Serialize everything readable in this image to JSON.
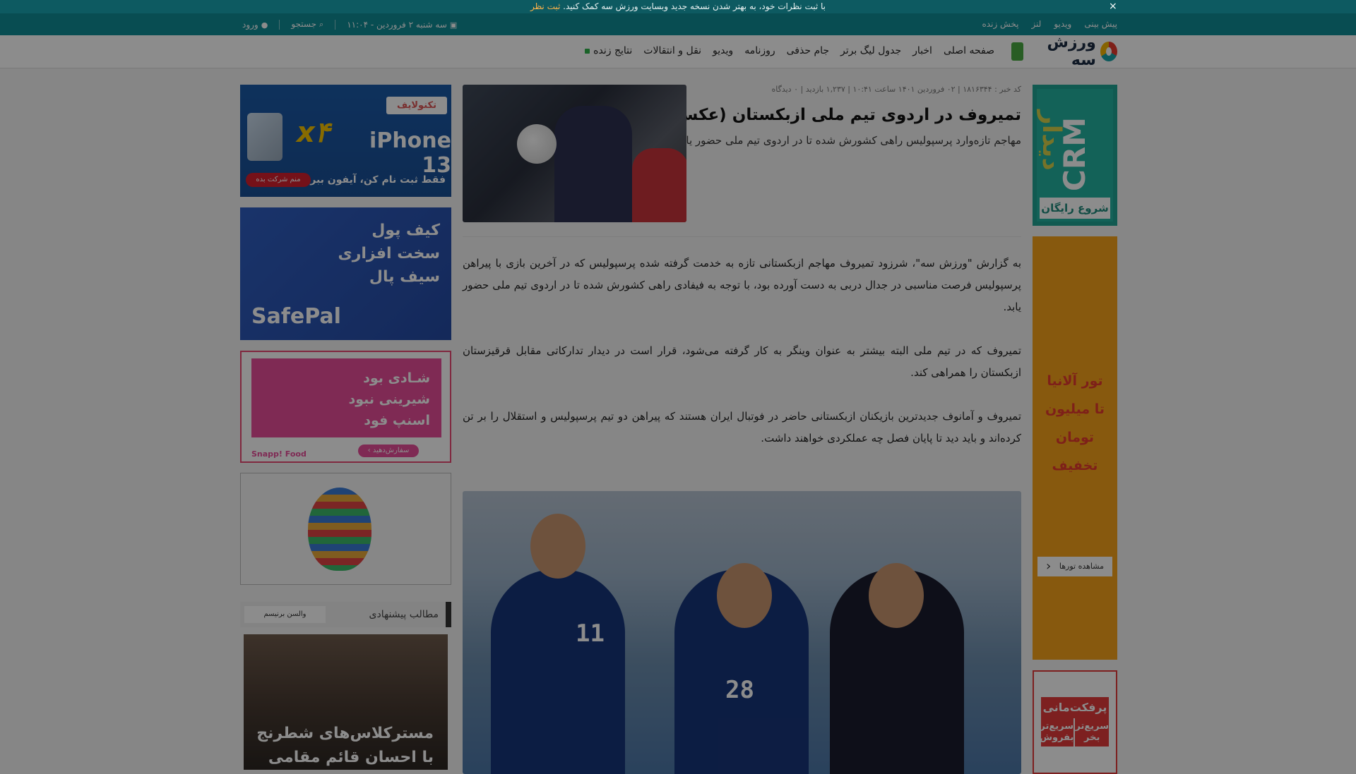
{
  "banner": {
    "text": "با ثبت نظرات خود، به بهتر شدن نسخه جدید وبسایت ورزش سه کمک کنید.",
    "link": "ثبت نظر",
    "close": "×"
  },
  "topbar": {
    "links": [
      "پیش بینی",
      "ویدیو",
      "لنز",
      "پخش زنده"
    ],
    "date": "سه شنبه ۲ فروردین - ۱۱:۰۴",
    "search": "جستجو",
    "login": "ورود"
  },
  "logo": {
    "text": "ورزش سه"
  },
  "nav": {
    "items": [
      "صفحه اصلی",
      "اخبار",
      "جدول لیگ برتر",
      "جام حذفی",
      "روزنامه",
      "ویدیو",
      "نقل و انتقالات"
    ],
    "live": "نتایج زنده"
  },
  "article": {
    "meta": "کد خبر : ۱۸۱۶۳۴۴ | ۰۲ فروردین ۱۴۰۱ ساعت ۱۰:۴۱ | ۱,۲۳۷ بازدید | ۰ دیدگاه",
    "title": "تمیروف در اردوی تیم ملی ازبکستان (عکس)",
    "lead": "مهاجم تازه‌وارد پرسپولیس راهی کشورش شده تا در اردوی تیم ملی حضور یابد.",
    "paragraphs": [
      "به گزارش \"ورزش سه\"، شرزود تمیروف مهاجم ازبکستانی تازه به خدمت گرفته شده پرسپولیس که در آخرین بازی با پیراهن پرسپولیس فرصت مناسبی در جدال دربی به دست آورده بود، با توجه به فیفادی راهی کشورش شده تا در اردوی تیم ملی حضور یابد.",
      "تمیروف که در تیم ملی البته بیشتر به عنوان وینگر به کار گرفته می‌شود، قرار است در دیدار تدارکاتی مقابل قرقیزستان ازبکستان را همراهی کند.",
      "تمیروف و آمانوف جدیدترین بازیکنان ازبکستانی حاضر در فوتبال ایران هستند که پیراهن دو تیم پرسپولیس و استقلال را بر تن کرده‌اند و باید دید تا پایان فصل چه عملکردی خواهند داشت."
    ],
    "photo_numbers": [
      "11",
      "28"
    ]
  },
  "ads": {
    "crm": {
      "title": "CRM",
      "brand": "دیدار",
      "button": "شروع رایگان"
    },
    "tour": {
      "lines": [
        "تور آلانیا",
        "تا میلیون تومان",
        "تخفیف"
      ],
      "button": "مشاهده تورها"
    },
    "perfect": {
      "title": "پرفکت‌مانی",
      "left": "سریع‌تر بفروش",
      "right": "سریع‌تر بخر"
    },
    "iphone": {
      "brand": "تکنولایف",
      "model": "iPhone 13",
      "multiplier": "x۴",
      "cta": "فقط ثبت نام کن، آیفون ببر!",
      "button": "منم شرکت بده"
    },
    "safepal": {
      "lines": [
        "کیف پول",
        "سخت افزاری",
        "سیف پال"
      ],
      "name": "SafePal"
    },
    "snapp": {
      "lines": [
        "شـادی بود",
        "شیرینی نبود",
        "اسنپ فود"
      ],
      "button": "سفارش‌دهید ›",
      "brand": "Snapp! Food"
    }
  },
  "suggest": {
    "title": "مطالب پیشنهادی",
    "tag": "والسن برنیسم",
    "caption_lines": [
      "مسترکلاس‌های شطرنج",
      "با احسان قائم مقامی"
    ]
  }
}
